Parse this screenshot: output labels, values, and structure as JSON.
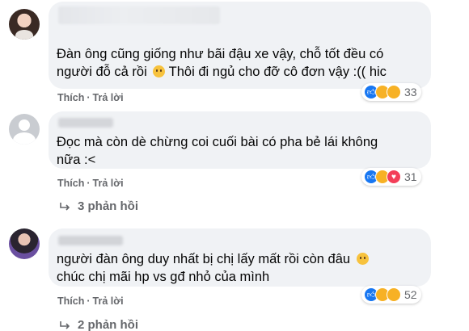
{
  "comments": [
    {
      "text_line1": "Đàn ông cũng giống như bãi đậu xe vậy, chỗ tốt đều có",
      "text_line2": "người đỗ cả rồi",
      "text_line2b": "Thôi đi ngủ cho đỡ cô đơn vậy :(( hic",
      "reaction_count": "33",
      "reactions": [
        "like",
        "haha",
        "sad"
      ]
    },
    {
      "text_line1": "Đọc mà còn dè chừng coi cuối bài có pha bẻ lái không",
      "text_line2": "nữa :<",
      "reaction_count": "31",
      "reactions": [
        "like",
        "haha",
        "love"
      ],
      "replies_label": "3 phản hồi"
    },
    {
      "text_line1": "người đàn ông duy nhất bị chị lấy mất rồi còn đâu",
      "text_line2": "chúc chị mãi hp vs gđ nhỏ của mình",
      "reaction_count": "52",
      "reactions": [
        "like",
        "haha",
        "wow"
      ],
      "replies_label": "2 phản hồi"
    }
  ],
  "actions": {
    "like_label": "Thích",
    "separator": "·",
    "reply_label": "Trả lời"
  },
  "colors": {
    "bubble": "#f0f2f5",
    "meta_text": "#65676b",
    "like_blue": "#1877f2",
    "love_red": "#f33e58",
    "emoji_yellow": "#f7b125"
  }
}
